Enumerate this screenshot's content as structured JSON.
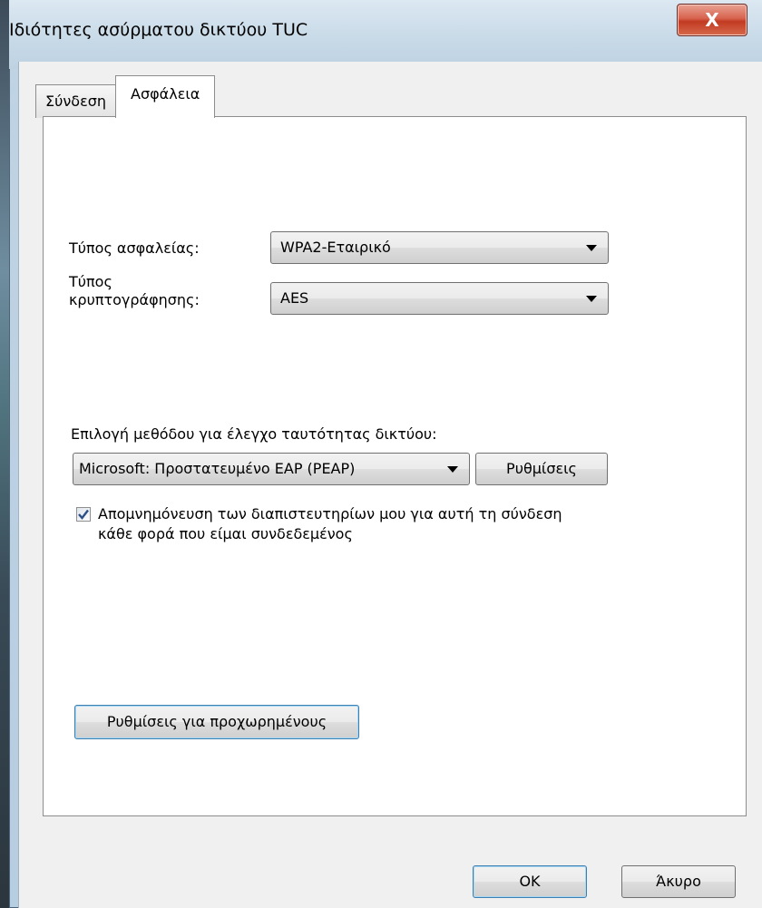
{
  "window": {
    "title": "Ιδιότητες ασύρματου δικτύου TUC",
    "close_glyph": "X"
  },
  "tabs": [
    {
      "label": "Σύνδεση",
      "active": false
    },
    {
      "label": "Ασφάλεια",
      "active": true
    }
  ],
  "security": {
    "security_type_label": "Τύπος ασφαλείας:",
    "security_type_value": "WPA2-Εταιρικό",
    "encryption_label_line1": "Τύπος",
    "encryption_label_line2": "κρυπτογράφησης:",
    "encryption_value": "AES",
    "auth_method_label": "Επιλογή μεθόδου για έλεγχο ταυτότητας δικτύου:",
    "auth_method_value": "Microsoft: Προστατευμένο EAP (PEAP)",
    "settings_button": "Ρυθμίσεις",
    "remember_checked": true,
    "remember_line1": "Απομνημόνευση των διαπιστευτηρίων μου για αυτή τη σύνδεση",
    "remember_line2": "κάθε φορά που είμαι συνδεδεμένος",
    "advanced_button": "Ρυθμίσεις για προχωρημένους"
  },
  "footer": {
    "ok": "OK",
    "cancel": "Άκυρο"
  },
  "icons": {
    "dropdown": "chevron-down-icon",
    "check": "check-icon",
    "close": "close-icon"
  },
  "colors": {
    "close_button": "#c23a22",
    "checkmark": "#2b4f86",
    "focus_border": "#3c7fb1"
  }
}
